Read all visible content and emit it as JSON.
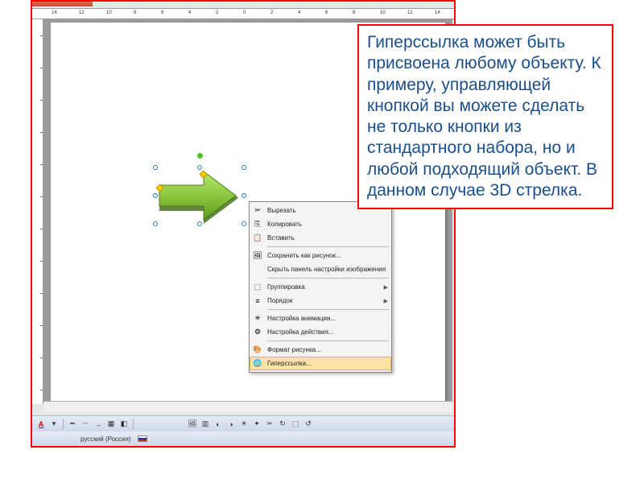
{
  "ruler_marks_h": [
    "14",
    "12",
    "10",
    "8",
    "6",
    "4",
    "2",
    "0",
    "2",
    "4",
    "6",
    "8",
    "10",
    "12",
    "14"
  ],
  "arrow_color": "#8cc63f",
  "context_menu": {
    "items": [
      {
        "icon": "✂",
        "label": "Вырезать"
      },
      {
        "icon": "📄",
        "label": "Копировать"
      },
      {
        "icon": "📋",
        "label": "Вставить"
      },
      {
        "sep": true
      },
      {
        "icon": "🖼",
        "label": "Сохранить как рисунок..."
      },
      {
        "icon": "",
        "label": "Скрыть панель настройки изображения"
      },
      {
        "sep": true
      },
      {
        "icon": "⬚",
        "label": "Группировка",
        "sub": true
      },
      {
        "icon": "≡",
        "label": "Порядок",
        "sub": true
      },
      {
        "sep": true
      },
      {
        "icon": "✳",
        "label": "Настройка анимации..."
      },
      {
        "icon": "⚙",
        "label": "Настройка действия..."
      },
      {
        "sep": true
      },
      {
        "icon": "🎨",
        "label": "Формат рисунка..."
      },
      {
        "icon": "🌐",
        "label": "Гиперссылка...",
        "hl": true
      }
    ]
  },
  "annotation_text": "Гиперссылка может быть присвоена любому объекту. К примеру, управляющей кнопкой вы можете сделать не только кнопки из стандартного набора, но и любой подходящий объект. В данном случае 3D стрелка.",
  "status": {
    "lang": "русский (Россия)"
  },
  "toolbar_font_color": "A"
}
